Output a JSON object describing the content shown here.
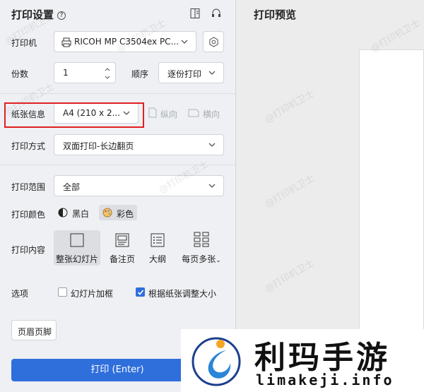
{
  "settings": {
    "title": "打印设置",
    "printer_label": "打印机",
    "printer_value": "RICOH MP C3504ex PC...",
    "copies_label": "份数",
    "copies_value": "1",
    "order_label": "顺序",
    "order_value": "逐份打印",
    "paper_label": "纸张信息",
    "paper_value": "A4 (210 x 2...",
    "portrait_label": "纵向",
    "landscape_label": "横向",
    "method_label": "打印方式",
    "method_value": "双面打印-长边翻页",
    "range_label": "打印范围",
    "range_value": "全部",
    "color_label": "打印颜色",
    "bw_label": "黑白",
    "color_value_label": "彩色",
    "content_label": "打印内容",
    "content_options": [
      "整张幻灯片",
      "备注页",
      "大纲",
      "每页多张"
    ],
    "options_label": "选项",
    "frame_label": "幻灯片加框",
    "fit_label": "根据纸张调整大小",
    "header_footer_label": "页眉页脚",
    "print_button": "打印 (Enter)"
  },
  "preview": {
    "title": "打印预览"
  },
  "logo": {
    "title": "利玛手游",
    "url": "limakeji.info"
  },
  "watermark": "@打印机卫士",
  "colors": {
    "accent": "#2f6fdc",
    "highlight": "#e02020"
  }
}
